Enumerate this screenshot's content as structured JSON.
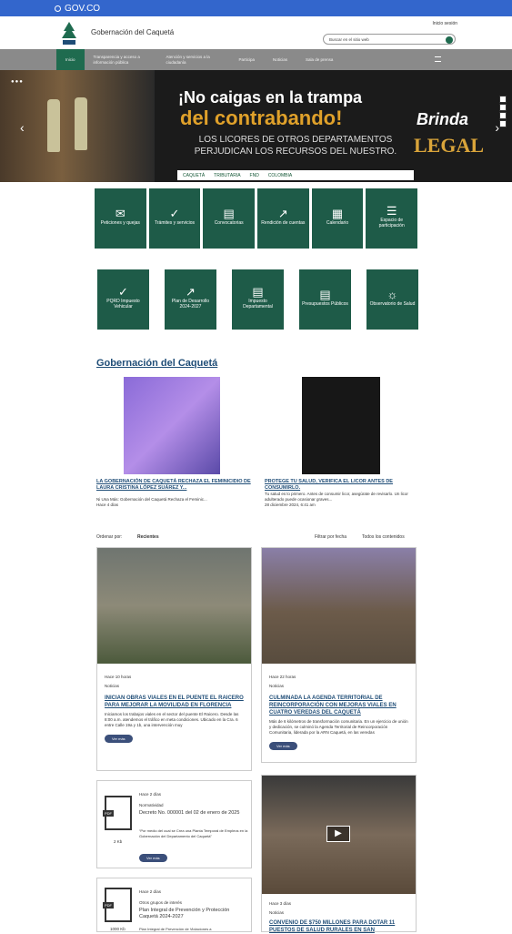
{
  "gov_bar": {
    "brand": "GOV.CO"
  },
  "header": {
    "site_title": "Gobernación del Caquetá",
    "login": "Inicio sesión",
    "search_placeholder": "Buscar en el sitio web"
  },
  "nav": {
    "items": [
      "Inicio",
      "Transparencia y acceso a información pública",
      "Atención y servicios a la ciudadanía",
      "Participa",
      "Noticias",
      "Sala de prensa"
    ]
  },
  "banner": {
    "headline1": "¡No caigas en la trampa",
    "headline2": "del contrabando!",
    "subtext": "LOS LICORES DE OTROS DEPARTAMENTOS PERJUDICAN LOS RECURSOS DEL NUESTRO.",
    "brinda": "Brinda",
    "legal": "LEGAL",
    "strip_logos": [
      "CAQUETÁ",
      "TRIBUTARIA",
      "FND",
      "COLOMBIA"
    ]
  },
  "tiles_row1": [
    {
      "icon": "✉",
      "label": "Peticiones y quejas"
    },
    {
      "icon": "✓",
      "label": "Trámites y servicios"
    },
    {
      "icon": "▤",
      "label": "Convocatorias"
    },
    {
      "icon": "↗",
      "label": "Rendición de cuentas"
    },
    {
      "icon": "▦",
      "label": "Calendario"
    },
    {
      "icon": "☰",
      "label": "Espacio de participación"
    }
  ],
  "tiles_row2": [
    {
      "icon": "✓",
      "label": "PQRD Impuesto Vehicular"
    },
    {
      "icon": "↗",
      "label": "Plan de Desarrollo 2024-2027"
    },
    {
      "icon": "▤",
      "label": "Impuesto Departamental"
    },
    {
      "icon": "▤",
      "label": "Presupuestos Públicos"
    },
    {
      "icon": "☼",
      "label": "Observatorio de Salud"
    }
  ],
  "section_title": "Gobernación del Caquetá",
  "featured": [
    {
      "title": "LA GOBERNACIÓN DE CAQUETÁ RECHAZA EL FEMINICIDIO DE LAURA CRISTINA LÓPEZ SUÁREZ Y...",
      "desc": "Ni Una Más: Gobernación del Caquetá Rechaza el Feminic...",
      "time": "Hace 4 días"
    },
    {
      "title": "PROTEGE TU SALUD, VERIFICA EL LICOR ANTES DE CONSUMIRLO.",
      "desc": "Tu salud es lo primero. Antes de consumir licor, asegúrate de revisarlo. Un licor adulterado puede ocasionar graves...",
      "time": "28 diciembre 2024, 6:41 am"
    }
  ],
  "filters": {
    "order_label": "Ordenar por:",
    "order_value": "Recientes",
    "filter_date": "Filtrar por fecha",
    "filter_content": "Todos los contenidos"
  },
  "posts": [
    {
      "time": "Hace 10 horas",
      "category": "Noticias",
      "title": "INICIAN OBRAS VIALES EN EL PUENTE EL RAICERO PARA MEJORAR LA MOVILIDAD EN FLORENCIA",
      "desc": "Iniciamos los trabajos viales en el sector del puente El Raicero. Desde las 8:00 a.m. atendemos el tráfico en meta condiciones. Ubicado en la Cra. 6 entre Calle 19a y 1b, una intervención muy",
      "button": "Ver más"
    },
    {
      "time": "Hace 22 horas",
      "category": "Noticias",
      "title": "CULMINADA LA AGENDA TERRITORIAL DE REINCORPORACIÓN CON MEJORAS VIALES EN CUATRO VEREDAS DEL CAQUETÁ",
      "desc": "Más de 6 kilómetros de transformación comunitaria. En un ejercicio de unión y dedicación, se culminó la Agenda Territorial de Reincorporación Comunitaria, liderada por la ARN Caquetá, en las veredas",
      "button": "Ver más"
    }
  ],
  "docs": [
    {
      "time": "Hace 2 días",
      "category": "Normatividad",
      "title": "Decreto No. 000001 del 02 de enero de 2025",
      "desc": "“Por medio del cual se Crea una Planta Temporal de Empleos en la Gobernación del Departamento del Caquetá”",
      "size": "2 Kb",
      "tag": "PDF",
      "button": "Ver más"
    },
    {
      "time": "Hace 2 días",
      "category": "Otros grupos de interés",
      "title": "Plan Integral de Prevención y Protección Caquetá 2024-2027",
      "desc": "Plan Integral de Prevención de Violaciones a",
      "size": "1000 Kb",
      "tag": "PDF"
    }
  ],
  "video_post": {
    "time": "Hace 3 días",
    "category": "Noticias",
    "title": "CONVENIO DE $750 MILLONES PARA DOTAR 11 PUESTOS DE SALUD RURALES EN SAN"
  }
}
